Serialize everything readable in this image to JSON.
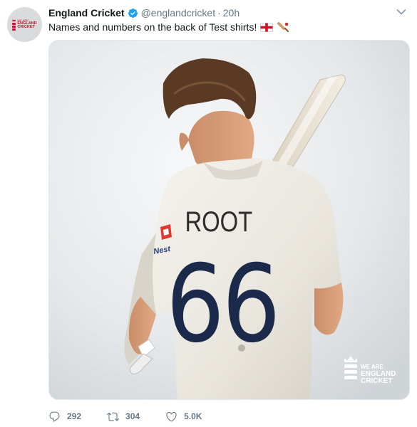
{
  "tweet": {
    "author_name": "England Cricket",
    "handle": "@englandcricket",
    "separator": "·",
    "time": "20h",
    "text": "Names and numbers on the back of Test shirts!",
    "emojis": [
      "flag-england-emoji",
      "cricket-bat-emoji"
    ],
    "verified": true
  },
  "avatar": {
    "line1": "WE ARE",
    "line2": "ENGLAND",
    "line3": "CRICKET"
  },
  "media": {
    "shirt_name": "ROOT",
    "shirt_number": "66",
    "sponsor": "Nest",
    "logo_line1": "WE ARE",
    "logo_line2": "ENGLAND",
    "logo_line3": "CRICKET"
  },
  "actions": {
    "replies": "292",
    "retweets": "304",
    "likes": "5.0K"
  },
  "colors": {
    "text": "#14171a",
    "secondary": "#657786",
    "verified": "#1da1f2",
    "brand_red": "#c8102e",
    "navy": "#1b2a4a"
  }
}
